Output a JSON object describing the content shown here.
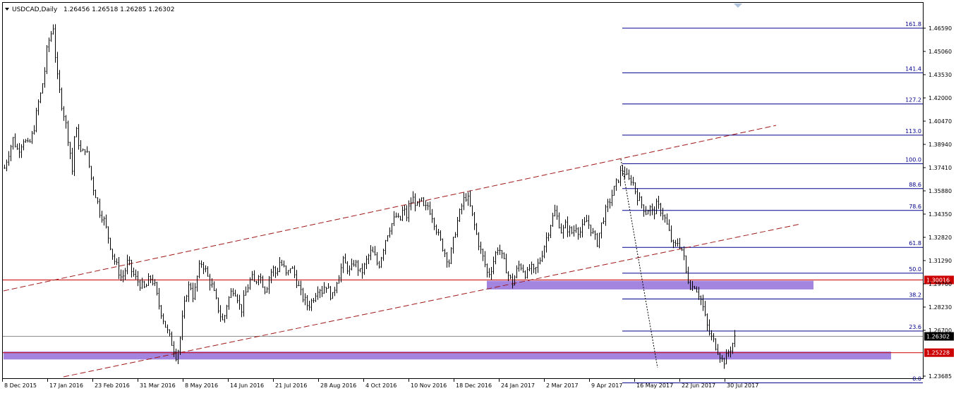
{
  "chart_data": {
    "type": "candlestick",
    "header": {
      "symbol": "USDCAD,Daily",
      "ohlc": "1.26456 1.26518 1.26285 1.26302"
    },
    "ylim": [
      1.2315,
      1.4745
    ],
    "y_ticks": [
      "1.46590",
      "1.45060",
      "1.43530",
      "1.42000",
      "1.40470",
      "1.38940",
      "1.37410",
      "1.35880",
      "1.34350",
      "1.32820",
      "1.31290",
      "1.29760",
      "1.28230",
      "1.26700",
      "1.23685"
    ],
    "x_ticks": [
      "8 Dec 2015",
      "17 Jan 2016",
      "23 Feb 2016",
      "31 Mar 2016",
      "8 May 2016",
      "14 Jun 2016",
      "21 Jul 2016",
      "28 Aug 2016",
      "4 Oct 2016",
      "10 Nov 2016",
      "18 Dec 2016",
      "24 Jan 2017",
      "2 Mar 2017",
      "9 Apr 2017",
      "16 May 2017",
      "22 Jun 2017",
      "30 Jul 2017"
    ],
    "price_path": [
      [
        0,
        1.353
      ],
      [
        5,
        1.372
      ],
      [
        10,
        1.381
      ],
      [
        18,
        1.393
      ],
      [
        25,
        1.385
      ],
      [
        33,
        1.393
      ],
      [
        40,
        1.388
      ],
      [
        47,
        1.398
      ],
      [
        53,
        1.415
      ],
      [
        58,
        1.424
      ],
      [
        63,
        1.438
      ],
      [
        67,
        1.455
      ],
      [
        71,
        1.461
      ],
      [
        75,
        1.467
      ],
      [
        78,
        1.448
      ],
      [
        81,
        1.433
      ],
      [
        86,
        1.418
      ],
      [
        92,
        1.405
      ],
      [
        98,
        1.388
      ],
      [
        102,
        1.372
      ],
      [
        106,
        1.402
      ],
      [
        110,
        1.393
      ],
      [
        115,
        1.382
      ],
      [
        121,
        1.388
      ],
      [
        126,
        1.375
      ],
      [
        131,
        1.362
      ],
      [
        136,
        1.355
      ],
      [
        141,
        1.345
      ],
      [
        146,
        1.341
      ],
      [
        151,
        1.332
      ],
      [
        155,
        1.325
      ],
      [
        160,
        1.315
      ],
      [
        166,
        1.308
      ],
      [
        172,
        1.301
      ],
      [
        176,
        1.305
      ],
      [
        181,
        1.313
      ],
      [
        186,
        1.306
      ],
      [
        192,
        1.301
      ],
      [
        199,
        1.297
      ],
      [
        205,
        1.294
      ],
      [
        212,
        1.302
      ],
      [
        218,
        1.298
      ],
      [
        224,
        1.285
      ],
      [
        230,
        1.276
      ],
      [
        236,
        1.267
      ],
      [
        241,
        1.261
      ],
      [
        246,
        1.255
      ],
      [
        250,
        1.249
      ],
      [
        255,
        1.262
      ],
      [
        259,
        1.278
      ],
      [
        264,
        1.292
      ],
      [
        269,
        1.298
      ],
      [
        274,
        1.288
      ],
      [
        279,
        1.302
      ],
      [
        284,
        1.312
      ],
      [
        289,
        1.309
      ],
      [
        294,
        1.302
      ],
      [
        300,
        1.296
      ],
      [
        306,
        1.286
      ],
      [
        311,
        1.278
      ],
      [
        316,
        1.272
      ],
      [
        321,
        1.284
      ],
      [
        326,
        1.291
      ],
      [
        331,
        1.295
      ],
      [
        336,
        1.289
      ],
      [
        341,
        1.279
      ],
      [
        346,
        1.289
      ],
      [
        351,
        1.296
      ],
      [
        356,
        1.302
      ],
      [
        361,
        1.297
      ],
      [
        366,
        1.305
      ],
      [
        371,
        1.299
      ],
      [
        376,
        1.293
      ],
      [
        381,
        1.302
      ],
      [
        386,
        1.308
      ],
      [
        391,
        1.304
      ],
      [
        396,
        1.312
      ],
      [
        401,
        1.309
      ],
      [
        406,
        1.302
      ],
      [
        411,
        1.309
      ],
      [
        416,
        1.305
      ],
      [
        421,
        1.298
      ],
      [
        426,
        1.291
      ],
      [
        431,
        1.287
      ],
      [
        436,
        1.283
      ],
      [
        441,
        1.286
      ],
      [
        446,
        1.291
      ],
      [
        451,
        1.296
      ],
      [
        456,
        1.293
      ],
      [
        461,
        1.298
      ],
      [
        466,
        1.292
      ],
      [
        471,
        1.289
      ],
      [
        476,
        1.299
      ],
      [
        481,
        1.305
      ],
      [
        486,
        1.312
      ],
      [
        491,
        1.309
      ],
      [
        496,
        1.305
      ],
      [
        501,
        1.312
      ],
      [
        506,
        1.309
      ],
      [
        511,
        1.304
      ],
      [
        516,
        1.309
      ],
      [
        521,
        1.315
      ],
      [
        526,
        1.319
      ],
      [
        531,
        1.315
      ],
      [
        536,
        1.309
      ],
      [
        541,
        1.318
      ],
      [
        546,
        1.327
      ],
      [
        551,
        1.334
      ],
      [
        556,
        1.338
      ],
      [
        561,
        1.342
      ],
      [
        566,
        1.338
      ],
      [
        571,
        1.347
      ],
      [
        576,
        1.342
      ],
      [
        581,
        1.351
      ],
      [
        586,
        1.354
      ],
      [
        591,
        1.348
      ],
      [
        596,
        1.353
      ],
      [
        601,
        1.346
      ],
      [
        606,
        1.349
      ],
      [
        611,
        1.344
      ],
      [
        616,
        1.337
      ],
      [
        621,
        1.329
      ],
      [
        626,
        1.323
      ],
      [
        631,
        1.317
      ],
      [
        636,
        1.312
      ],
      [
        641,
        1.323
      ],
      [
        646,
        1.335
      ],
      [
        651,
        1.344
      ],
      [
        656,
        1.352
      ],
      [
        661,
        1.356
      ],
      [
        666,
        1.348
      ],
      [
        671,
        1.338
      ],
      [
        676,
        1.328
      ],
      [
        681,
        1.319
      ],
      [
        686,
        1.312
      ],
      [
        691,
        1.303
      ],
      [
        696,
        1.308
      ],
      [
        701,
        1.316
      ],
      [
        706,
        1.323
      ],
      [
        711,
        1.315
      ],
      [
        716,
        1.309
      ],
      [
        721,
        1.302
      ],
      [
        726,
        1.298
      ],
      [
        731,
        1.305
      ],
      [
        736,
        1.311
      ],
      [
        741,
        1.307
      ],
      [
        746,
        1.303
      ],
      [
        751,
        1.309
      ],
      [
        756,
        1.305
      ],
      [
        761,
        1.309
      ],
      [
        766,
        1.315
      ],
      [
        771,
        1.323
      ],
      [
        776,
        1.331
      ],
      [
        781,
        1.339
      ],
      [
        786,
        1.345
      ],
      [
        791,
        1.339
      ],
      [
        796,
        1.331
      ],
      [
        801,
        1.336
      ],
      [
        806,
        1.333
      ],
      [
        811,
        1.331
      ],
      [
        816,
        1.336
      ],
      [
        821,
        1.331
      ],
      [
        826,
        1.335
      ],
      [
        831,
        1.339
      ],
      [
        836,
        1.335
      ],
      [
        841,
        1.329
      ],
      [
        846,
        1.325
      ],
      [
        851,
        1.335
      ],
      [
        856,
        1.343
      ],
      [
        861,
        1.349
      ],
      [
        866,
        1.355
      ],
      [
        871,
        1.361
      ],
      [
        876,
        1.367
      ],
      [
        881,
        1.373
      ],
      [
        885,
        1.371
      ],
      [
        890,
        1.365
      ],
      [
        895,
        1.367
      ],
      [
        900,
        1.359
      ],
      [
        905,
        1.353
      ],
      [
        910,
        1.349
      ],
      [
        915,
        1.345
      ],
      [
        920,
        1.348
      ],
      [
        925,
        1.344
      ],
      [
        930,
        1.349
      ],
      [
        935,
        1.347
      ],
      [
        940,
        1.343
      ],
      [
        945,
        1.336
      ],
      [
        950,
        1.328
      ],
      [
        955,
        1.321
      ],
      [
        960,
        1.325
      ],
      [
        964,
        1.323
      ],
      [
        968,
        1.317
      ],
      [
        972,
        1.305
      ],
      [
        976,
        1.299
      ],
      [
        980,
        1.295
      ],
      [
        984,
        1.297
      ],
      [
        988,
        1.293
      ],
      [
        992,
        1.289
      ],
      [
        996,
        1.282
      ],
      [
        1000,
        1.273
      ],
      [
        1004,
        1.266
      ],
      [
        1008,
        1.262
      ],
      [
        1012,
        1.259
      ],
      [
        1016,
        1.255
      ],
      [
        1020,
        1.251
      ],
      [
        1024,
        1.246
      ],
      [
        1028,
        1.248
      ],
      [
        1032,
        1.253
      ],
      [
        1036,
        1.256
      ],
      [
        1040,
        1.261
      ],
      [
        1043,
        1.263
      ]
    ],
    "fibonacci": {
      "levels": [
        {
          "label": "161.8",
          "price": 1.4659
        },
        {
          "label": "141.4",
          "price": 1.4365
        },
        {
          "label": "127.2",
          "price": 1.416
        },
        {
          "label": "113.0",
          "price": 1.3955
        },
        {
          "label": "100.0",
          "price": 1.3767
        },
        {
          "label": "88.6",
          "price": 1.3603
        },
        {
          "label": "78.6",
          "price": 1.3459
        },
        {
          "label": "61.8",
          "price": 1.3216
        },
        {
          "label": "50.0",
          "price": 1.3046
        },
        {
          "label": "38.2",
          "price": 1.2876
        },
        {
          "label": "23.6",
          "price": 1.2665
        },
        {
          "label": "0.0",
          "price": 1.2324
        }
      ]
    },
    "horizontal_lines": [
      {
        "price_label": "1.30016",
        "price": 1.30016,
        "color": "#cc0000"
      },
      {
        "price_label": "1.25228",
        "price": 1.25228,
        "color": "#cc0000"
      },
      {
        "price_label": "1.26302",
        "price": 1.26302,
        "color": "#8c8c8c"
      }
    ],
    "zones": [
      {
        "name": "resistance-zone",
        "from": 1.2939,
        "to": 1.2996,
        "color": "#9370db"
      },
      {
        "name": "support-zone",
        "from": 1.2478,
        "to": 1.253,
        "color": "#9370db"
      }
    ],
    "colors": {
      "candles": "#000000",
      "trendline": "#a01818",
      "fib_line": "#00008b",
      "box_text_red": "#ffffff"
    }
  }
}
